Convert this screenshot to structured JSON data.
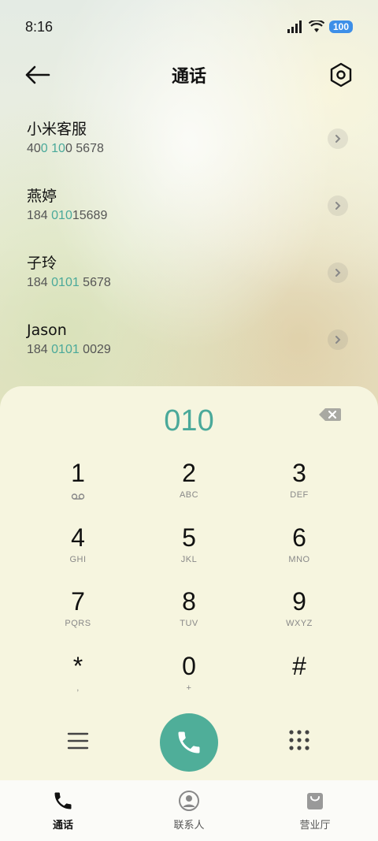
{
  "status": {
    "time": "8:16",
    "battery": "100"
  },
  "header": {
    "title": "通话"
  },
  "contacts": [
    {
      "name": "小米客服",
      "number_parts": [
        "40",
        "0 10",
        "0 5678"
      ]
    },
    {
      "name": "燕婷",
      "number_parts": [
        "184 ",
        "010",
        "15689"
      ]
    },
    {
      "name": "子玲",
      "number_parts": [
        "184 ",
        "0101",
        " 5678"
      ]
    },
    {
      "name": "Jason",
      "number_parts": [
        "184 ",
        "0101",
        " 0029"
      ]
    }
  ],
  "dialpad": {
    "display": "010",
    "keys": [
      {
        "digit": "1",
        "letters": ""
      },
      {
        "digit": "2",
        "letters": "ABC"
      },
      {
        "digit": "3",
        "letters": "DEF"
      },
      {
        "digit": "4",
        "letters": "GHI"
      },
      {
        "digit": "5",
        "letters": "JKL"
      },
      {
        "digit": "6",
        "letters": "MNO"
      },
      {
        "digit": "7",
        "letters": "PQRS"
      },
      {
        "digit": "8",
        "letters": "TUV"
      },
      {
        "digit": "9",
        "letters": "WXYZ"
      },
      {
        "digit": "*",
        "letters": ","
      },
      {
        "digit": "0",
        "letters": "+"
      },
      {
        "digit": "#",
        "letters": ""
      }
    ]
  },
  "tabs": [
    {
      "label": "通话",
      "icon": "phone-icon",
      "active": true
    },
    {
      "label": "联系人",
      "icon": "person-icon",
      "active": false
    },
    {
      "label": "营业厅",
      "icon": "shopping-bag-icon",
      "active": false
    }
  ],
  "colors": {
    "accent": "#4aa99a",
    "call_button": "#4fae99",
    "dialpad_bg": "#f6f5df"
  }
}
